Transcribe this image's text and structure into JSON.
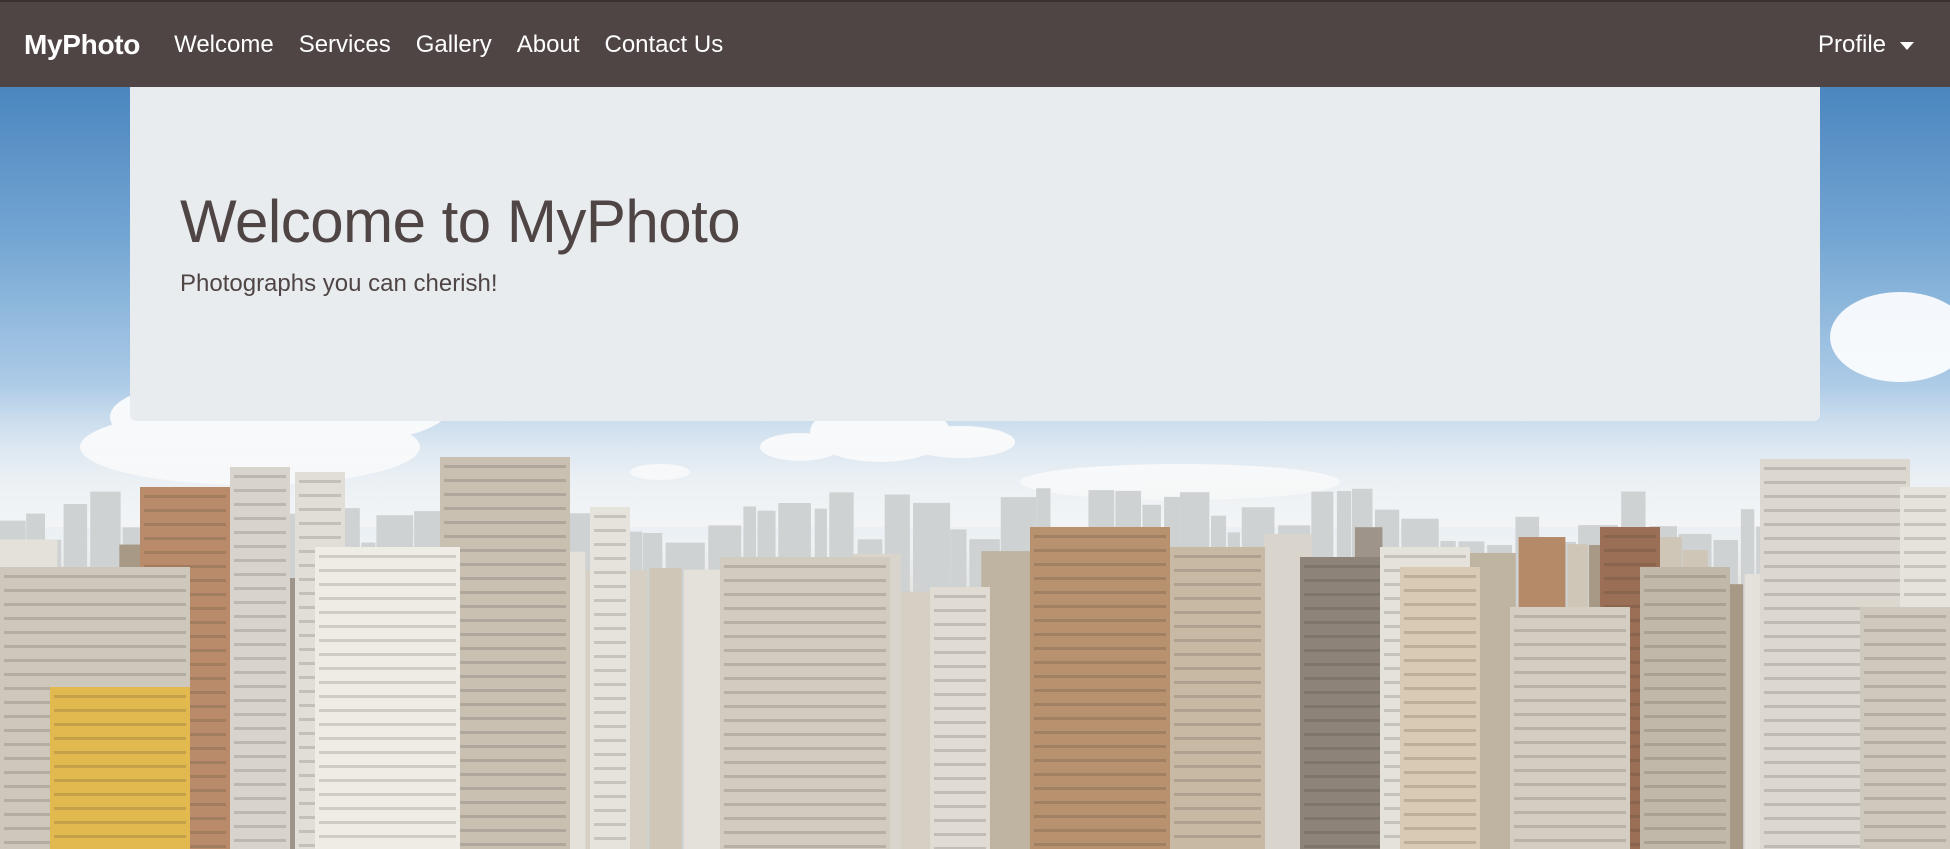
{
  "navbar": {
    "brand": "MyPhoto",
    "links": [
      {
        "label": "Welcome"
      },
      {
        "label": "Services"
      },
      {
        "label": "Gallery"
      },
      {
        "label": "About"
      },
      {
        "label": "Contact Us"
      }
    ],
    "profile_label": "Profile",
    "background_color": "#4f4545"
  },
  "jumbotron": {
    "title": "Welcome to MyPhoto",
    "subtitle": "Photographs you can cherish!",
    "background_color": "#e9ecef",
    "text_color": "#4f4545"
  },
  "background": {
    "subject": "city-skyline"
  },
  "icons": {
    "profile_caret": "caret-down-icon"
  }
}
